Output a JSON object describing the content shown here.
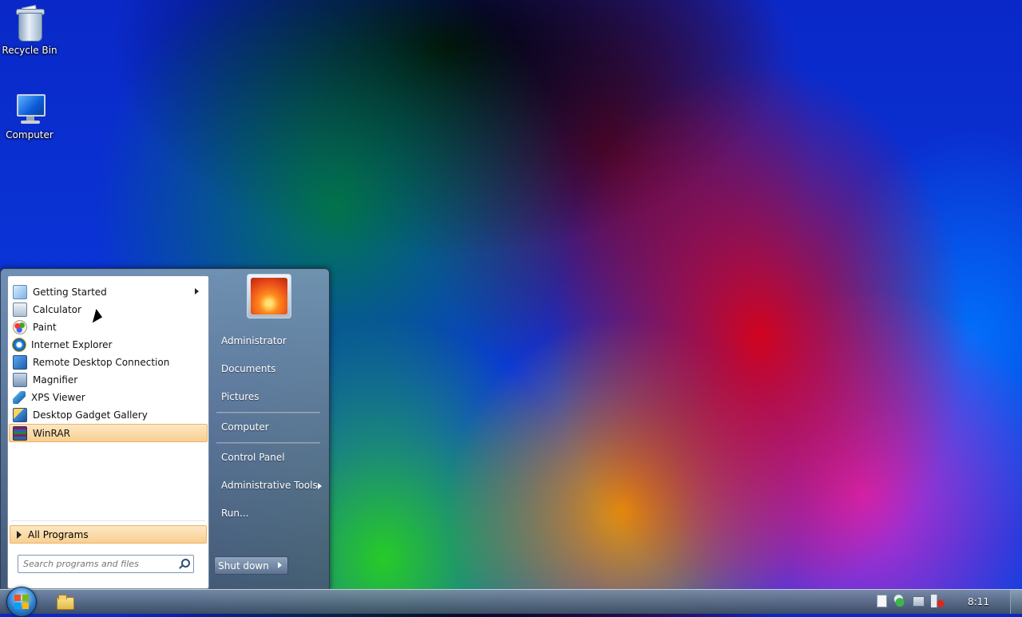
{
  "desktop": {
    "icons": [
      {
        "label": "Recycle Bin",
        "icon": "recycle-bin-icon"
      },
      {
        "label": "Computer",
        "icon": "computer-icon"
      }
    ]
  },
  "start_menu": {
    "programs": [
      {
        "label": "Getting Started",
        "icon": "getting-started-icon",
        "has_submenu": true
      },
      {
        "label": "Calculator",
        "icon": "calculator-icon"
      },
      {
        "label": "Paint",
        "icon": "paint-icon"
      },
      {
        "label": "Internet Explorer",
        "icon": "internet-explorer-icon"
      },
      {
        "label": "Remote Desktop Connection",
        "icon": "remote-desktop-icon"
      },
      {
        "label": "Magnifier",
        "icon": "magnifier-icon"
      },
      {
        "label": "XPS Viewer",
        "icon": "xps-viewer-icon"
      },
      {
        "label": "Desktop Gadget Gallery",
        "icon": "gadget-gallery-icon"
      },
      {
        "label": "WinRAR",
        "icon": "winrar-icon",
        "highlighted": true
      }
    ],
    "all_programs_label": "All Programs",
    "search_placeholder": "Search programs and files",
    "right_links": [
      {
        "label": "Administrator"
      },
      {
        "label": "Documents"
      },
      {
        "label": "Pictures"
      },
      {
        "label": "Computer"
      },
      {
        "label": "Control Panel"
      },
      {
        "label": "Administrative Tools",
        "has_submenu": true
      },
      {
        "label": "Run..."
      }
    ],
    "shutdown_label": "Shut down"
  },
  "taskbar": {
    "clock": "8:11",
    "pinned": [
      "windows-explorer-icon"
    ],
    "tray_icons": [
      "action-center-icon",
      "security-icon",
      "network-icon",
      "volume-muted-icon"
    ]
  },
  "colors": {
    "highlight": "#f9cf90",
    "highlight_border": "#e9b56b"
  }
}
